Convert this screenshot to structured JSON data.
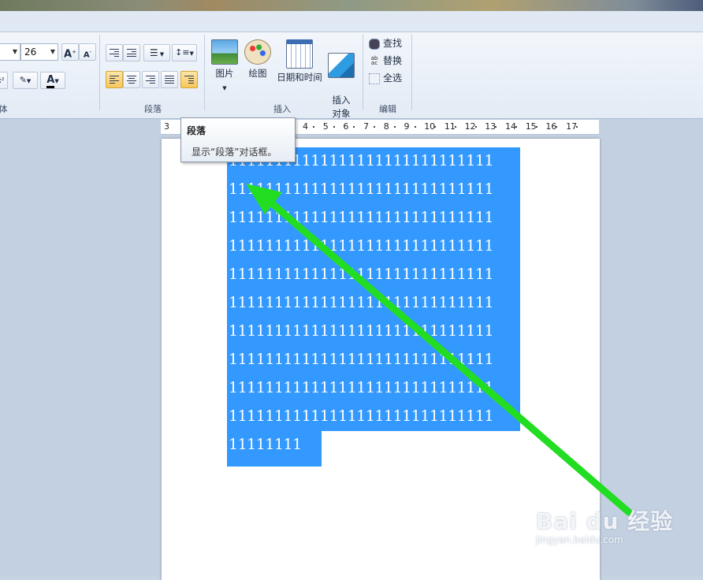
{
  "font_group": {
    "size_value": "26",
    "grow_icon": "A",
    "shrink_icon": "A",
    "color_icon": "A",
    "label_partial": "体"
  },
  "paragraph_group": {
    "label": "段落",
    "active_button": "paragraph-dialog"
  },
  "insert_group": {
    "label": "插入",
    "picture": "图片",
    "paint": "绘图",
    "datetime": "日期和时间",
    "object": "插入\n对象"
  },
  "edit_group": {
    "label": "编辑",
    "find": "查找",
    "replace": "替换",
    "select_all": "全选"
  },
  "ruler": {
    "ticks": [
      "3",
      "4",
      "5",
      "6",
      "7",
      "8",
      "9",
      "10",
      "11",
      "12",
      "13",
      "14",
      "15",
      "16",
      "17"
    ]
  },
  "tooltip": {
    "title": "段落",
    "description": "显示“段落”对话框。"
  },
  "document": {
    "line": "11111111111111111111111111111",
    "last_line": "11111111",
    "line_count": 10
  },
  "colors": {
    "selection": "#3399ff",
    "arrow": "#22dd22",
    "active_button": "#f7c75a"
  },
  "watermark": {
    "main": "Bai du 经验",
    "sub": "jingyan.baidu.com"
  }
}
